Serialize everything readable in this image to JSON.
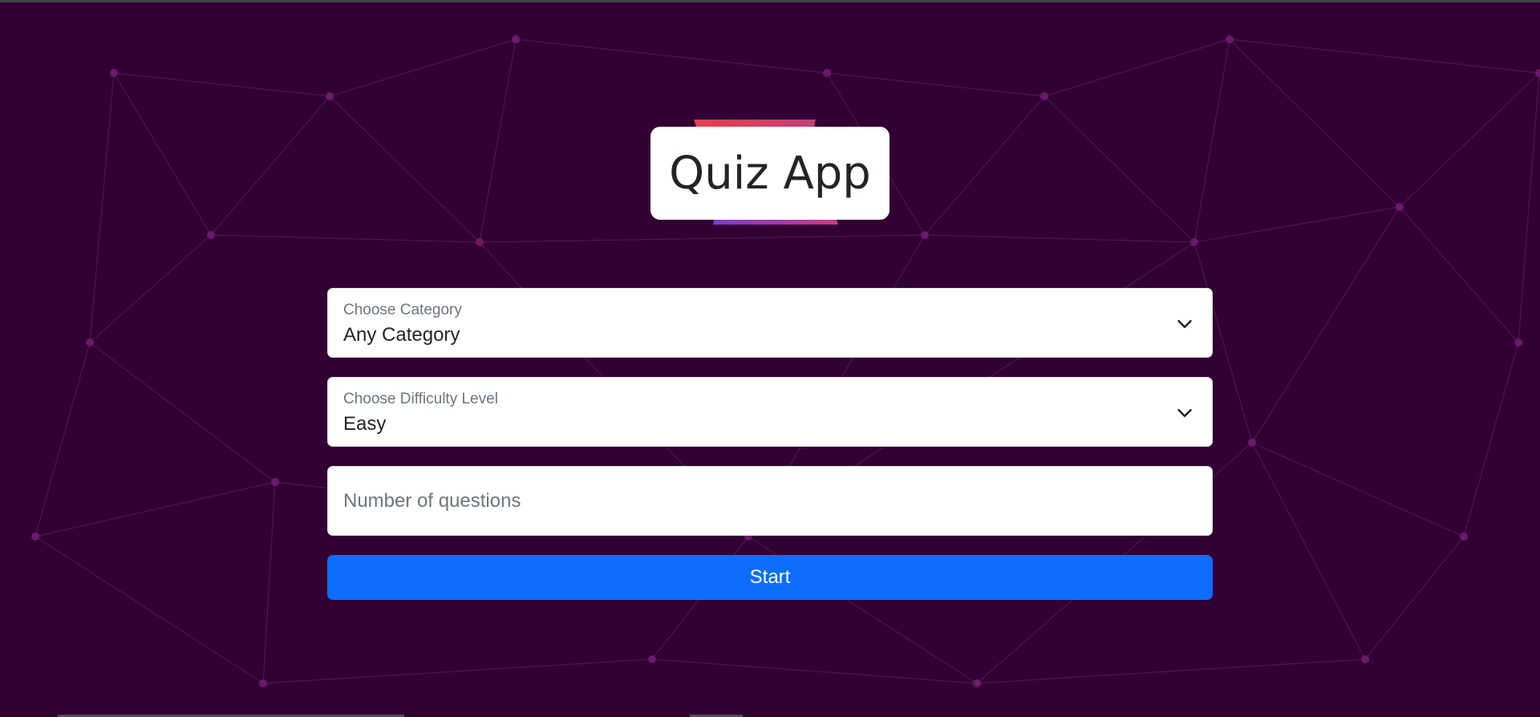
{
  "app": {
    "title": "Quiz App"
  },
  "form": {
    "category": {
      "label": "Choose Category",
      "selected": "Any Category"
    },
    "difficulty": {
      "label": "Choose Difficulty Level",
      "selected": "Easy"
    },
    "questions": {
      "value": "",
      "placeholder": "Number of questions"
    },
    "start_label": "Start"
  },
  "colors": {
    "background": "#330033",
    "network_line": "#4a1a4a",
    "network_node": "#6b1a6b",
    "primary_button": "#0d6efd",
    "logo_stripe_top": "#e3404d",
    "logo_stripe_bottom": "#7a3ec6"
  },
  "icons": {
    "select_chevron": "chevron-down-icon"
  }
}
